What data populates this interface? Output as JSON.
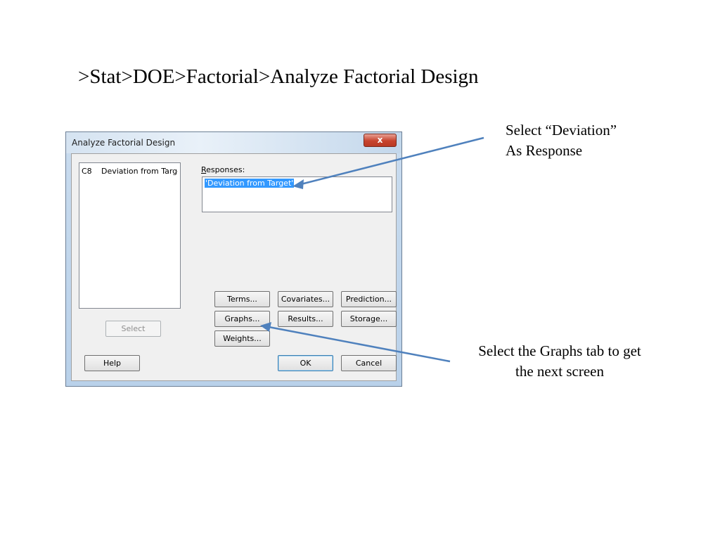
{
  "slide": {
    "title": ">Stat>DOE>Factorial>Analyze Factorial Design",
    "callout_response_line1": "Select “Deviation”",
    "callout_response_line2": "As Response",
    "callout_graphs_line1": "Select the Graphs tab to get",
    "callout_graphs_line2": "the next screen",
    "arrow_color": "#4f81bd"
  },
  "dialog": {
    "title": "Analyze Factorial Design",
    "close_label": "x",
    "variables": [
      {
        "column": "C8",
        "name": "Deviation from Targe"
      }
    ],
    "responses_label_accel": "R",
    "responses_label_rest": "esponses:",
    "responses_value": "'Deviation from Target'",
    "buttons": {
      "terms": "Terms...",
      "covariates": "Covariates...",
      "prediction": "Prediction...",
      "graphs": "Graphs...",
      "results": "Results...",
      "storage": "Storage...",
      "weights": "Weights...",
      "select": "Select",
      "help": "Help",
      "ok": "OK",
      "cancel": "Cancel"
    }
  }
}
